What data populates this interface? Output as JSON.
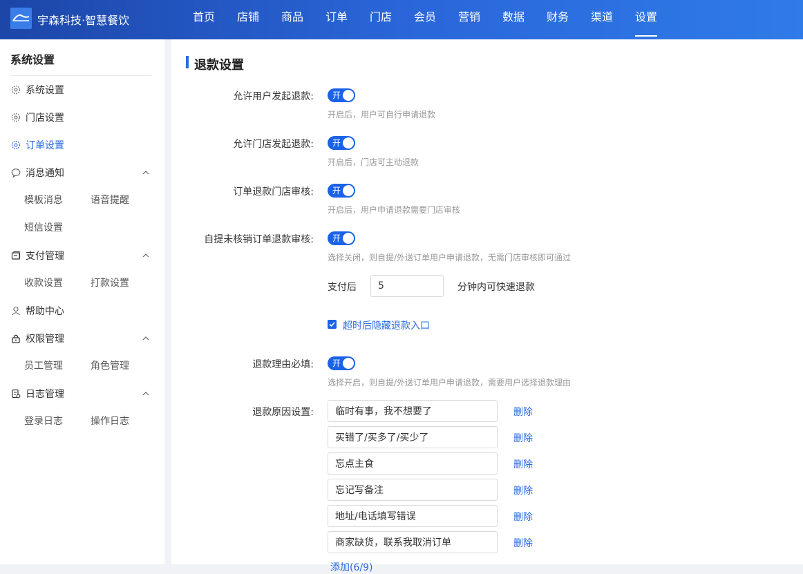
{
  "header": {
    "brand": "宇森科技·智慧餐饮",
    "nav": [
      "首页",
      "店铺",
      "商品",
      "订单",
      "门店",
      "会员",
      "营销",
      "数据",
      "财务",
      "渠道",
      "设置"
    ],
    "active_nav": "设置"
  },
  "sidebar": {
    "title": "系统设置",
    "items": [
      {
        "label": "系统设置",
        "icon": "gear-icon"
      },
      {
        "label": "门店设置",
        "icon": "gear-icon"
      },
      {
        "label": "订单设置",
        "icon": "gear-icon",
        "active": true
      },
      {
        "label": "消息通知",
        "icon": "message-icon",
        "sub": [
          "模板消息",
          "语音提醒",
          "短信设置"
        ]
      },
      {
        "label": "支付管理",
        "icon": "wallet-icon",
        "sub": [
          "收款设置",
          "打款设置"
        ]
      },
      {
        "label": "帮助中心",
        "icon": "user-icon"
      },
      {
        "label": "权限管理",
        "icon": "lock-icon",
        "sub": [
          "员工管理",
          "角色管理"
        ]
      },
      {
        "label": "日志管理",
        "icon": "log-icon",
        "sub": [
          "登录日志",
          "操作日志"
        ]
      }
    ]
  },
  "main": {
    "section_title": "退款设置",
    "settings": [
      {
        "label": "允许用户发起退款:",
        "toggle": "开",
        "hint": "开启后，用户可自行申请退款"
      },
      {
        "label": "允许门店发起退款:",
        "toggle": "开",
        "hint": "开启后，门店可主动退款"
      },
      {
        "label": "订单退款门店审核:",
        "toggle": "开",
        "hint": "开启后，用户申请退款需要门店审核"
      },
      {
        "label": "自提未核销订单退款审核:",
        "toggle": "开",
        "hint": "选择关闭，则自提/外送订单用户申请退款，无需门店审核即可通过"
      }
    ],
    "quick_refund": {
      "prefix": "支付后",
      "value": "5",
      "suffix": "分钟内可快速退款"
    },
    "hide_entry_checkbox": {
      "label": "超时后隐藏退款入口",
      "checked": true
    },
    "reason_required": {
      "label": "退款理由必填:",
      "toggle": "开",
      "hint": "选择开启，则自提/外送订单用户申请退款，需要用户选择退款理由"
    },
    "reasons": {
      "label": "退款原因设置:",
      "items": [
        "临时有事，我不想要了",
        "买错了/买多了/买少了",
        "忘点主食",
        "忘记写备注",
        "地址/电话填写错误",
        "商家缺货，联系我取消订单"
      ],
      "delete_label": "删除",
      "add_label": "添加(6/9)"
    }
  }
}
